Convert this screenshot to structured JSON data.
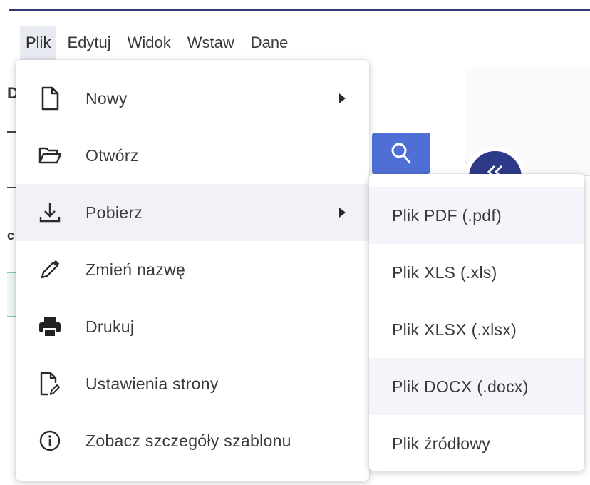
{
  "menubar": {
    "items": [
      {
        "label": "Plik",
        "active": true
      },
      {
        "label": "Edytuj"
      },
      {
        "label": "Widok"
      },
      {
        "label": "Wstaw"
      },
      {
        "label": "Dane"
      }
    ]
  },
  "background": {
    "letter_d": "D",
    "letter_c": "c",
    "search_icon": "search-icon",
    "collapse_icon": "double-chevron-icon"
  },
  "file_menu": {
    "items": [
      {
        "label": "Nowy",
        "icon": "file-icon",
        "has_submenu": true
      },
      {
        "label": "Otwórz",
        "icon": "folder-open-icon",
        "has_submenu": false
      },
      {
        "label": "Pobierz",
        "icon": "download-icon",
        "has_submenu": true,
        "hovered": true
      },
      {
        "label": "Zmień nazwę",
        "icon": "pencil-icon",
        "has_submenu": false
      },
      {
        "label": "Drukuj",
        "icon": "printer-icon",
        "has_submenu": false
      },
      {
        "label": "Ustawienia strony",
        "icon": "page-settings-icon",
        "has_submenu": false
      },
      {
        "label": "Zobacz szczegóły szablonu",
        "icon": "info-icon",
        "has_submenu": false
      }
    ]
  },
  "download_submenu": {
    "items": [
      {
        "label": "Plik PDF (.pdf)",
        "hovered": true
      },
      {
        "label": "Plik XLS (.xls)"
      },
      {
        "label": "Plik XLSX (.xlsx)"
      },
      {
        "label": "Plik DOCX (.docx)",
        "hovered": true
      },
      {
        "label": "Plik źródłowy"
      }
    ]
  },
  "colors": {
    "accent": "#2e3a70",
    "search_button": "#4f6fd6",
    "circle_button": "#2d3a87",
    "menubar_active": "#e8eaf2",
    "menu_hover": "#f2f2f6"
  }
}
